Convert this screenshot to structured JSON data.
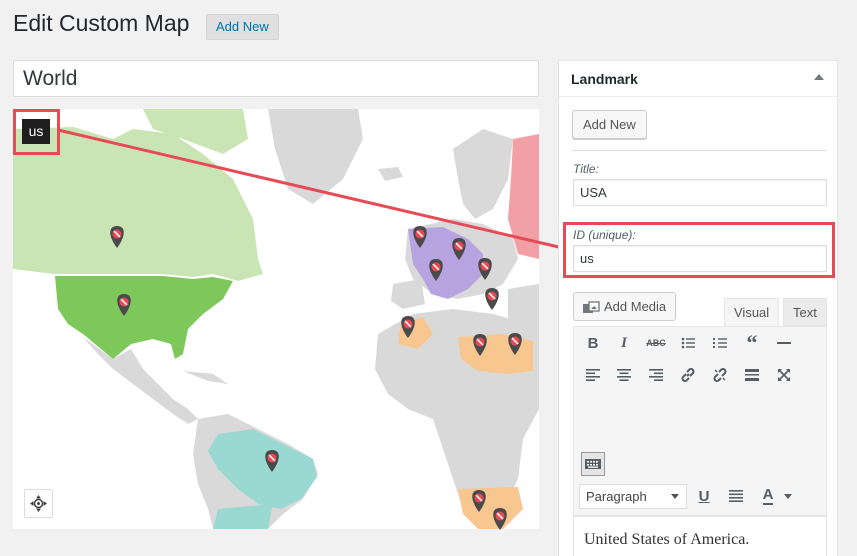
{
  "page": {
    "title": "Edit Custom Map",
    "add_new_label": "Add New"
  },
  "map": {
    "name": "World",
    "tooltip": "us",
    "colors": {
      "north_america": "#c9e5b3",
      "usa": "#7ec75a",
      "europe_highlight": "#b7a3e0",
      "north_africa": "#f7c78f",
      "brazil": "#9ad9d2",
      "russia": "#f2a0a5",
      "land": "#d9d9d9",
      "accent": "#e84b55"
    },
    "markers": [
      "pin-icon"
    ]
  },
  "panel": {
    "title": "Landmark",
    "add_new_label": "Add New",
    "title_label": "Title:",
    "title_value": "USA",
    "id_label": "ID (unique):",
    "id_value": "us",
    "add_media_label": "Add Media",
    "tab_visual": "Visual",
    "tab_text": "Text",
    "format_value": "Paragraph",
    "content": "United States of America."
  }
}
